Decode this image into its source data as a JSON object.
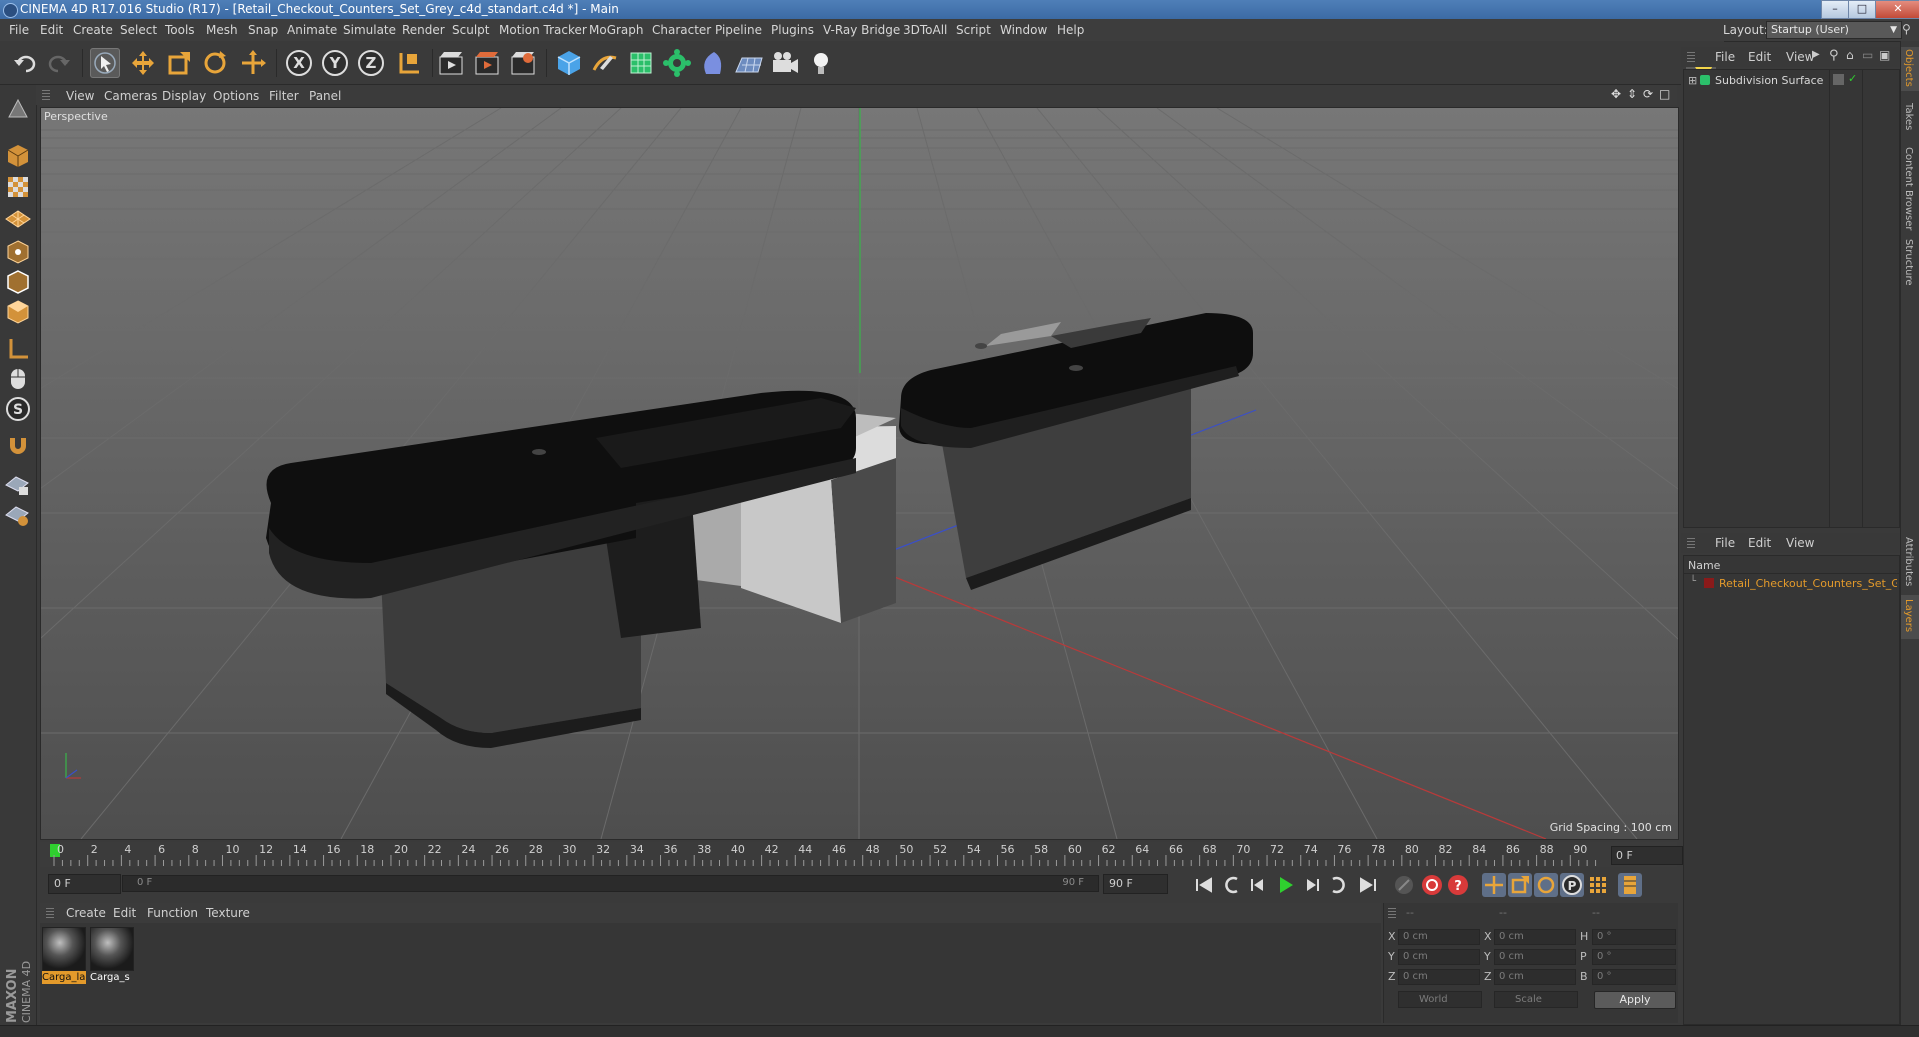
{
  "window": {
    "title": "CINEMA 4D R17.016 Studio (R17) - [Retail_Checkout_Counters_Set_Grey_c4d_standart.c4d *] - Main"
  },
  "menubar": {
    "items": [
      "File",
      "Edit",
      "Create",
      "Select",
      "Tools",
      "Mesh",
      "Snap",
      "Animate",
      "Simulate",
      "Render",
      "Sculpt",
      "Motion Tracker",
      "MoGraph",
      "Character",
      "Pipeline",
      "Plugins",
      "V-Ray Bridge",
      "3DToAll",
      "Script",
      "Window",
      "Help"
    ],
    "layout_label": "Layout:",
    "layout_value": "Startup (User)"
  },
  "viewport": {
    "menu": [
      "View",
      "Cameras",
      "Display",
      "Options",
      "Filter",
      "Panel"
    ],
    "camera_label": "Perspective",
    "grid_spacing": "Grid Spacing : 100 cm"
  },
  "timeline": {
    "ticks": [
      "0",
      "2",
      "4",
      "6",
      "8",
      "10",
      "12",
      "14",
      "16",
      "18",
      "20",
      "22",
      "24",
      "26",
      "28",
      "30",
      "32",
      "34",
      "36",
      "38",
      "40",
      "42",
      "44",
      "46",
      "48",
      "50",
      "52",
      "54",
      "56",
      "58",
      "60",
      "62",
      "64",
      "66",
      "68",
      "70",
      "72",
      "74",
      "76",
      "78",
      "80",
      "82",
      "84",
      "86",
      "88",
      "90"
    ],
    "current_frame": "0 F",
    "start_field": "0 F",
    "range_start": "0 F",
    "range_end": "90 F",
    "end_field": "90 F"
  },
  "materials": {
    "menu": [
      "Create",
      "Edit",
      "Function",
      "Texture"
    ],
    "items": [
      {
        "label": "Carga_la",
        "selected": true
      },
      {
        "label": "Carga_s",
        "selected": false
      }
    ]
  },
  "coords": {
    "header": [
      "--",
      "--",
      "--"
    ],
    "rows": [
      {
        "l1": "X",
        "v1": "0 cm",
        "l2": "X",
        "v2": "0 cm",
        "l3": "H",
        "v3": "0 °"
      },
      {
        "l1": "Y",
        "v1": "0 cm",
        "l2": "Y",
        "v2": "0 cm",
        "l3": "P",
        "v3": "0 °"
      },
      {
        "l1": "Z",
        "v1": "0 cm",
        "l2": "Z",
        "v2": "0 cm",
        "l3": "B",
        "v3": "0 °"
      }
    ],
    "mode_world": "World",
    "mode_scale": "Scale",
    "apply_label": "Apply"
  },
  "objects_panel": {
    "menu": [
      "File",
      "Edit",
      "View"
    ],
    "items": [
      {
        "name": "Subdivision Surface"
      }
    ]
  },
  "layers_panel": {
    "menu": [
      "File",
      "Edit",
      "View"
    ],
    "column_name": "Name",
    "items": [
      {
        "name": "Retail_Checkout_Counters_Set_Gr"
      }
    ]
  },
  "side_tabs": [
    "Objects",
    "Takes",
    "Content Browser",
    "Structure",
    "Attributes",
    "Layers"
  ],
  "branding": {
    "maxon": "MAXON",
    "cinema": "CINEMA 4D"
  },
  "colors": {
    "accent_orange": "#e39a2b",
    "x_axis": "#c0392b",
    "y_axis": "#2ecc40",
    "z_axis": "#3a5bd9",
    "play_green": "#2fd02f"
  }
}
